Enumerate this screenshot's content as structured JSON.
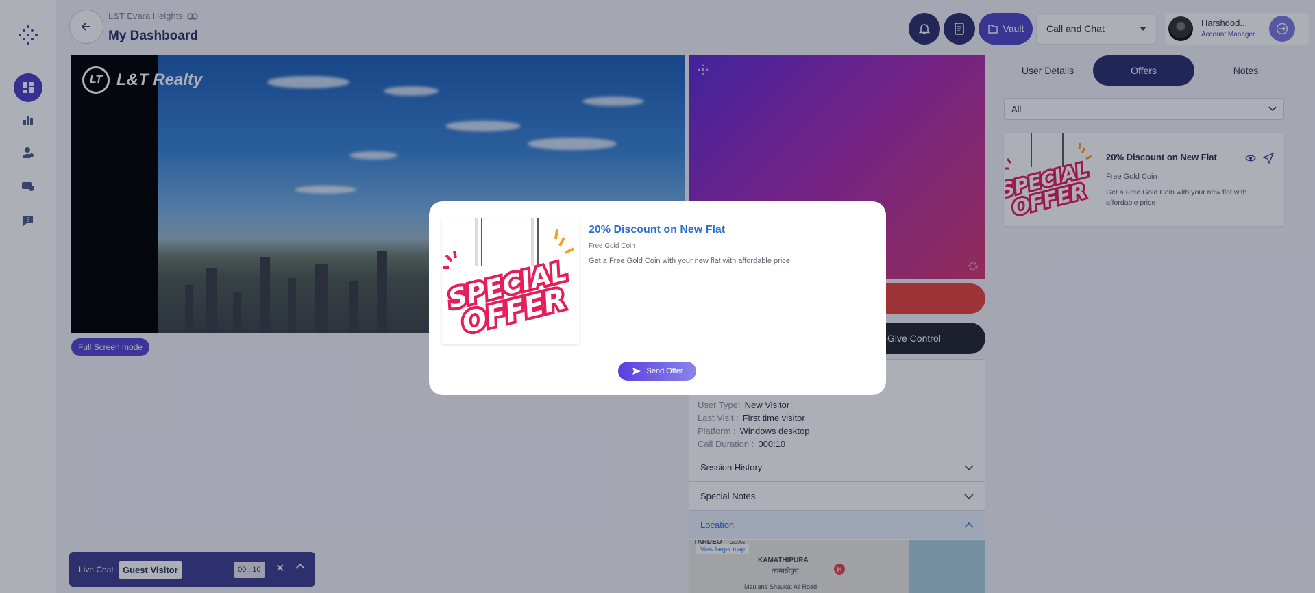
{
  "header": {
    "project": "L&T Evara Heights",
    "title": "My Dashboard",
    "vault_label": "Vault",
    "mode_select": "Call and Chat",
    "user_name": "Harshdod...",
    "user_role": "Account Manager"
  },
  "video": {
    "brand": "L&T Realty",
    "fullscreen_label": "Full Screen mode",
    "give_control_label": "Give Control"
  },
  "visitor": {
    "rows": [
      {
        "key": "User Type:",
        "value": "New Visitor"
      },
      {
        "key": "Last Visit :",
        "value": "First time visitor"
      },
      {
        "key": "Platform :",
        "value": "Windows desktop"
      },
      {
        "key": "Call Duration :",
        "value": "000:10"
      }
    ],
    "accordions": [
      "Session History",
      "Special Notes",
      "Location"
    ],
    "map": {
      "link": "View larger map",
      "labels": [
        "TARDEO",
        "तारदेव",
        "KAMATHIPURA",
        "कामाठीपुरा",
        "Maulana Shaukat Ali Road"
      ]
    }
  },
  "right_panel": {
    "tabs": [
      "User Details",
      "Offers",
      "Notes"
    ],
    "active_tab": "Offers",
    "filter_value": "All",
    "offer": {
      "title": "20% Discount on New Flat",
      "subtitle": "Free Gold Coin",
      "description": "Get a Free Gold Coin with your new flat with affordable price"
    }
  },
  "live_chat": {
    "label": "Live Chat",
    "visitor": "Guest Visitor",
    "timer": "00 : 10"
  },
  "modal": {
    "title": "20% Discount on New Flat",
    "subtitle": "Free Gold Coin",
    "description": "Get a Free Gold Coin with your new flat with affordable price",
    "send_label": "Send Offer",
    "image_text_1": "SPECIAL",
    "image_text_2": "OFFER"
  },
  "colors": {
    "accent": "#4b3fc7",
    "navy": "#2a2f6e",
    "danger": "#e9433e",
    "offer_pink": "#e51e5a"
  }
}
